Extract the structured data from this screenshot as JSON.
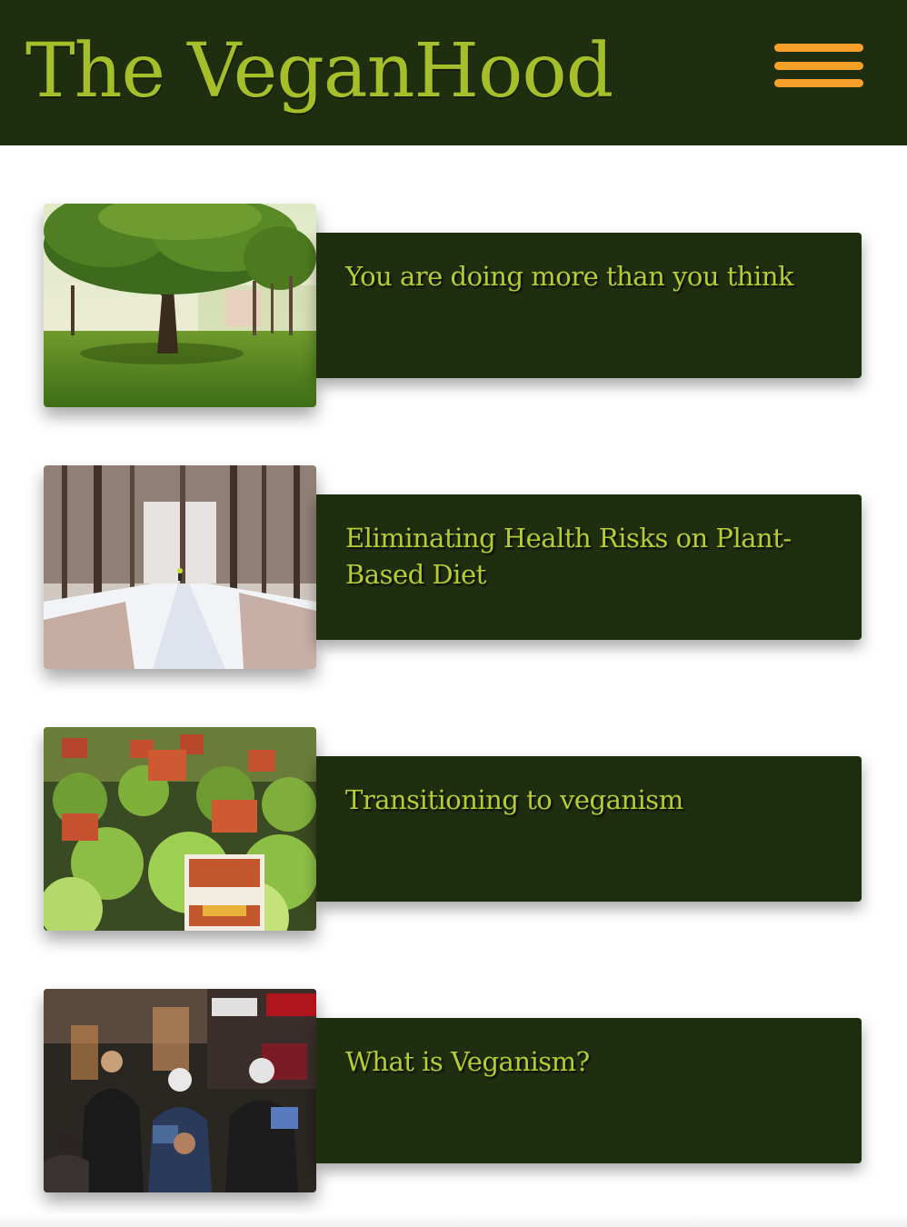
{
  "header": {
    "site_title": "The VeganHood",
    "menu_icon": "hamburger-menu-icon"
  },
  "colors": {
    "header_bg": "#202e10",
    "title": "#a4bf2a",
    "menu_accent": "#f5a028",
    "card_bg": "#202e10",
    "card_title": "#b5cc34"
  },
  "articles": [
    {
      "title": "You are doing more than you think",
      "image": "park-tree-photo"
    },
    {
      "title": "Eliminating Health Risks on Plant-Based Diet",
      "image": "snowy-forest-path-photo"
    },
    {
      "title": "Transitioning to veganism",
      "image": "basil-seedlings-photo"
    },
    {
      "title": "What is Veganism?",
      "image": "street-protest-night-photo"
    }
  ]
}
